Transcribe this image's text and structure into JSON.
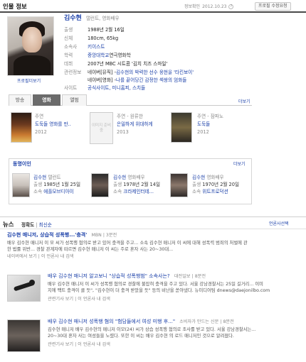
{
  "header": {
    "title": "인물 정보",
    "info_check": "정보확인",
    "date": "2012.10.23",
    "help_icon": "?",
    "edit_button": "프로필 수정요청"
  },
  "profile": {
    "name": "김수현",
    "job": "탤런트, 영화배우",
    "photo_link": "프로필더보기",
    "rows": [
      {
        "label": "출생",
        "value": "1988년 2월 16일"
      },
      {
        "label": "신체",
        "value": "180cm, 65kg"
      },
      {
        "label": "소속사",
        "value": "키이스트"
      },
      {
        "label": "학력",
        "value_link": "중앙대학교",
        "value": " 연극영화학"
      },
      {
        "label": "데뷔",
        "value": "2007년 MBC 시트콤 '김치 치즈 스마일'"
      }
    ],
    "related_label": "관련정보",
    "related": [
      {
        "prefix": "네이버[뮤직] - ",
        "text": "김수현의 박력한 선수 웅현을 '타킨보이'"
      },
      {
        "prefix": "네이버[영화] - ",
        "text": "나를 끝어당긴 감정한 섹쌍의 엄화들"
      }
    ],
    "site_label": "사이트",
    "sites": "공식사이트, 미니홈피, 스치들"
  },
  "tabs": {
    "items": [
      "방송",
      "영화",
      "앨범"
    ],
    "active": "영화",
    "more": "더보기"
  },
  "films": [
    {
      "role": "주연",
      "title": "도둑들 영화를 만..",
      "year": "2012"
    },
    {
      "role": "주연 - 원류한",
      "title": "은밀하게 위대하게",
      "year": "2013",
      "placeholder": "이미지 준비중"
    },
    {
      "role": "주연 - 잠파노",
      "title": "도둑들",
      "year": "2012"
    }
  ],
  "related_people": {
    "title": "동명이인",
    "more": "더보기",
    "people": [
      {
        "name": "김수현",
        "job": "탤런트",
        "birth_label": "출생",
        "birth": "1985년 1월 25일",
        "agency_label": "소속",
        "agency": "에플모브디아이"
      },
      {
        "name": "김수현",
        "job": "영화배우",
        "birth_label": "출생",
        "birth": "1978년 2월 14일",
        "agency_label": "소속",
        "agency": "크라제인터테..."
      },
      {
        "name": "김수현",
        "job": "영화배우",
        "birth_label": "출생",
        "birth": "1970년 2월 20일",
        "agency_label": "소속",
        "agency": "위트프로덕션"
      }
    ]
  },
  "news": {
    "title": "뉴스",
    "sort_accuracy": "정확도",
    "sort_latest": "최신순",
    "press_link": "언론사선택",
    "items": [
      {
        "title": "김수현 매니저, 상습적 성폭행...'충격'",
        "source": "MBN",
        "time": "3분전",
        "line1": "배우 김수현 매니저 이 모 씨가 성폭행 혐의로 받고 있어 충격을 주고... 소속 김수현 매니저 이 씨에 대해 성폭력 범죄의 처벌에 관",
        "line2": "한 법률 위반... 경찰 관계자에 따르면 김수현 매니저 이 씨는 주로 혼자 사는 20~30대...",
        "meta1": "네이버에서 보기",
        "meta2": "이 언론사 내 검색"
      },
      {
        "title": "배우 김수현 매니저 알고보니 \"상습적 성폭행범\" 소속사는?",
        "source": "대전일보",
        "time": "8분전",
        "line1": "배우 김수현 매니저 이 씨가 성폭행 혐의로 경찰에 불잡혀 충격을 주고 있다. 서울 강남경찰서는 25일 길거리... 이미",
        "line2": "지에 팩트 충격이 클 듯\", \"김수현이 더 충격 받았을 듯\" 등의 비난을 쏟아냈다. 뉴미디어팀 dnews@daejonilbo.com",
        "meta1": "관련기사 보기",
        "meta2": "이 언론사 내 검색"
      },
      {
        "title": "배우 김수현 매니저 성폭행 혐의 \"험담들에서 여성 미행 후...\"",
        "source": "소비자가 만드는 신문",
        "time": "8분전",
        "line1": "김수현 매니저 배우 김수현의 매니저 이모(24) 씨가 상습 성폭행 혐의로 조사를 받고 있다. 서울 강남경찰서는...",
        "line2": "20~30대 혼자 사는 여성들을 노렸다. 또한 이 씨는 배우 김수현 의 로드 매니저인 것으로 알려졌다.",
        "meta1": "관련기사 보기",
        "meta2": "이 언론사 내 검색"
      }
    ]
  }
}
